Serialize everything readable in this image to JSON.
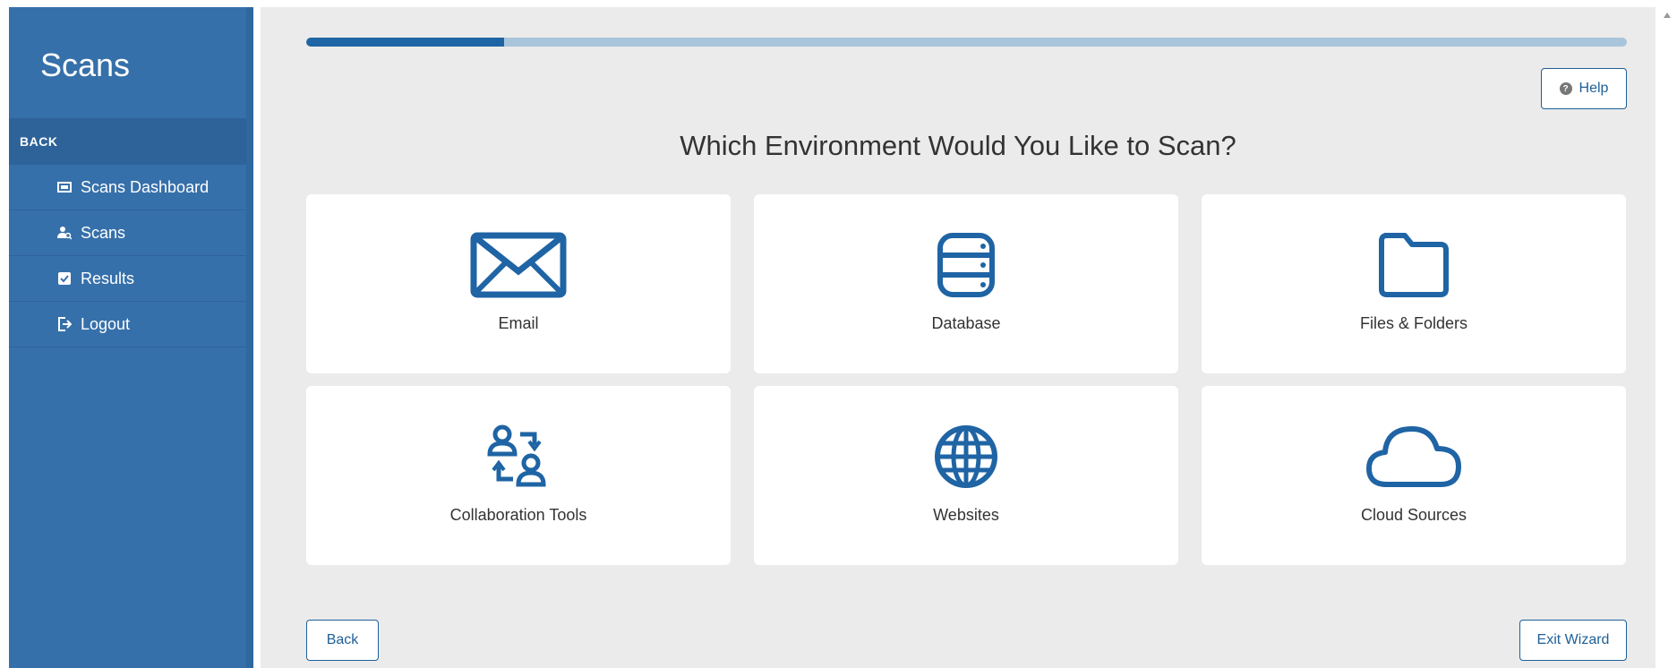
{
  "sidebar": {
    "title": "Scans",
    "back_label": "BACK",
    "items": [
      {
        "label": "Scans Dashboard",
        "icon": "dashboard-icon"
      },
      {
        "label": "Scans",
        "icon": "user-search-icon"
      },
      {
        "label": "Results",
        "icon": "checkbox-icon"
      },
      {
        "label": "Logout",
        "icon": "logout-icon"
      }
    ]
  },
  "wizard": {
    "progress_fraction": 0.15,
    "help_label": "Help",
    "heading": "Which Environment Would You Like to Scan?",
    "back_label": "Back",
    "exit_label": "Exit Wizard",
    "options": [
      {
        "label": "Email",
        "icon": "envelope-icon"
      },
      {
        "label": "Database",
        "icon": "database-icon"
      },
      {
        "label": "Files & Folders",
        "icon": "folder-icon"
      },
      {
        "label": "Collaboration Tools",
        "icon": "collaboration-icon"
      },
      {
        "label": "Websites",
        "icon": "globe-icon"
      },
      {
        "label": "Cloud Sources",
        "icon": "cloud-icon"
      }
    ]
  },
  "colors": {
    "sidebar": "#3670aa",
    "accent": "#1f64a4",
    "background": "#ebebeb"
  }
}
